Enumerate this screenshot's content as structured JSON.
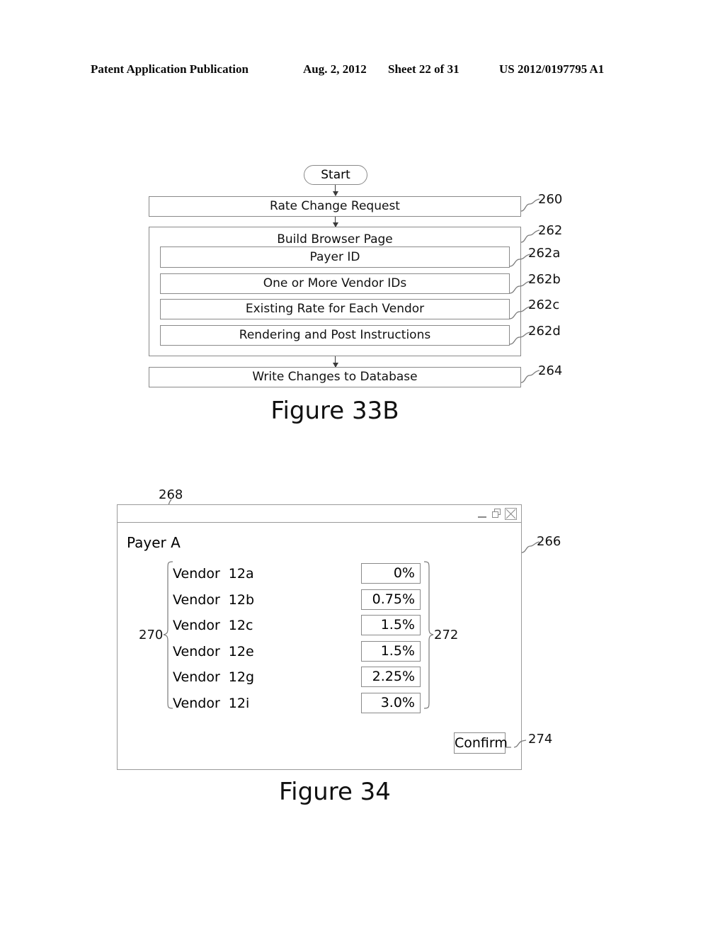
{
  "page_header": {
    "publication": "Patent Application Publication",
    "date": "Aug. 2, 2012",
    "sheet": "Sheet 22 of 31",
    "number": "US 2012/0197795 A1"
  },
  "figure_33b": {
    "caption": "Figure 33B",
    "start_label": "Start",
    "steps": [
      {
        "label": "Rate Change Request",
        "ref": "260"
      },
      {
        "label": "Build Browser Page",
        "ref": "262"
      },
      {
        "label": "Payer ID",
        "ref": "262a"
      },
      {
        "label": "One or More Vendor IDs",
        "ref": "262b"
      },
      {
        "label": "Existing Rate for Each Vendor",
        "ref": "262c"
      },
      {
        "label": "Rendering and Post Instructions",
        "ref": "262d"
      },
      {
        "label": "Write Changes to Database",
        "ref": "264"
      }
    ]
  },
  "figure_34": {
    "caption": "Figure 34",
    "window_ref": "266",
    "payer_ref": "268",
    "vendor_list_ref": "270",
    "rate_list_ref": "272",
    "confirm_ref": "274",
    "payer_label": "Payer A",
    "window_controls": {
      "minimize": "minimize-icon",
      "restore": "restore-icon",
      "close": "close-icon"
    },
    "vendor_word": "Vendor",
    "rows": [
      {
        "vendor_id": "12a",
        "rate": "0%"
      },
      {
        "vendor_id": "12b",
        "rate": "0.75%"
      },
      {
        "vendor_id": "12c",
        "rate": "1.5%"
      },
      {
        "vendor_id": "12e",
        "rate": "1.5%"
      },
      {
        "vendor_id": "12g",
        "rate": "2.25%"
      },
      {
        "vendor_id": "12i",
        "rate": "3.0%"
      }
    ],
    "confirm_label": "Confirm"
  }
}
